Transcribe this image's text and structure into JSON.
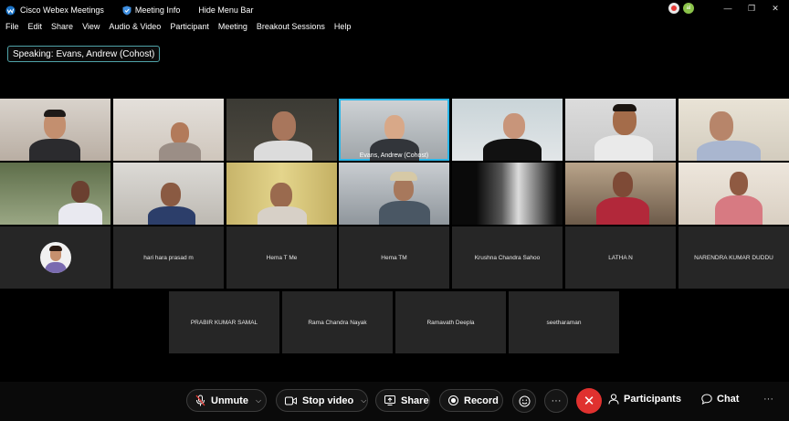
{
  "titlebar": {
    "app_title": "Cisco Webex Meetings",
    "meeting_info": "Meeting Info",
    "hide_menu": "Hide Menu Bar",
    "profile_initials": "al"
  },
  "menu": [
    "File",
    "Edit",
    "Share",
    "View",
    "Audio & Video",
    "Participant",
    "Meeting",
    "Breakout Sessions",
    "Help"
  ],
  "speaking": {
    "prefix": "Speaking:",
    "name": "Evans, Andrew (Cohost)"
  },
  "active_tile_name": "Evans, Andrew  (Cohost)",
  "name_tiles": [
    "hari hara prasad m",
    "Hema T Me",
    "Hema TM",
    "Krushna Chandra Sahoo",
    "LATHA N",
    "NARENDRA KUMAR DUDDU",
    "PRABIR KUMAR SAMAL",
    "Rama Chandra Nayak",
    "Ramavath Deepla",
    "seetharaman"
  ],
  "toolbar": {
    "unmute": "Unmute",
    "stop_video": "Stop video",
    "share": "Share",
    "record": "Record",
    "more": "···",
    "end": "✕",
    "participants": "Participants",
    "chat": "Chat",
    "overflow": "···"
  },
  "colors": {
    "accent": "#29b6e8",
    "speaking_border": "#4fa3a8",
    "end_call": "#e0312f"
  }
}
